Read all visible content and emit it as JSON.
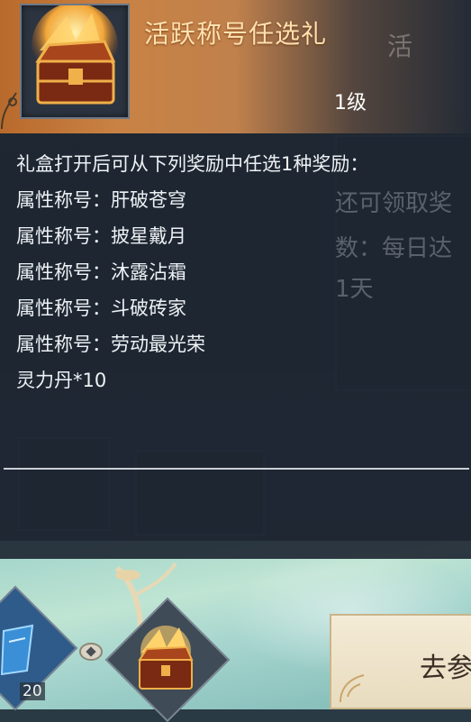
{
  "tooltip": {
    "title": "活跃称号任选礼",
    "level": "1级",
    "description": [
      "礼盒打开后可从下列奖励中任选1种奖励：",
      "属性称号：肝破苍穹",
      "属性称号：披星戴月",
      "属性称号：沐露沾霜",
      "属性称号：斗破砖家",
      "属性称号：劳动最光荣",
      "灵力丹*10"
    ]
  },
  "background": {
    "partial_title": "活",
    "partial_lines": [
      "还可领取奖",
      "数：每日达",
      "1天"
    ]
  },
  "bottom": {
    "slot_count": "20",
    "go_button_label": "去参"
  },
  "colors": {
    "header_orange": "#c98244",
    "title_text": "#ffe1b0",
    "panel_bg": "#1c2430"
  }
}
